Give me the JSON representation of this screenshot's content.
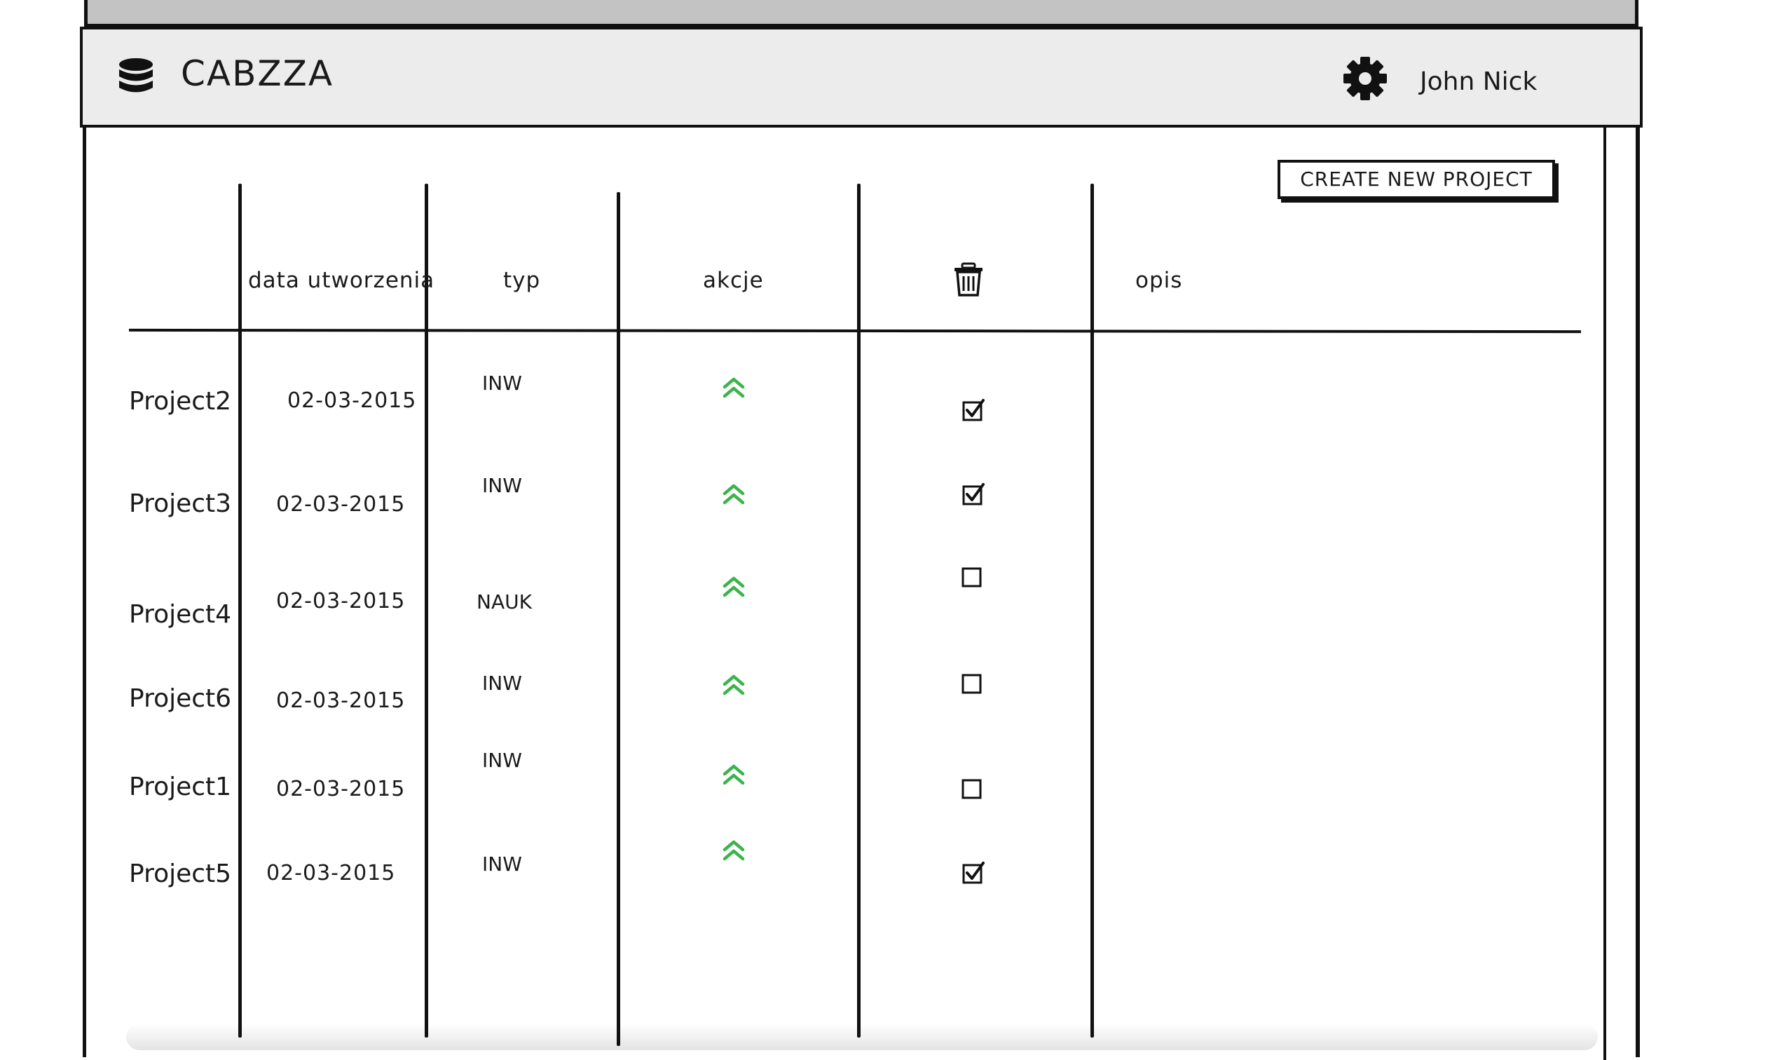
{
  "app": {
    "title": "CABZZA",
    "logo_icon": "database-icon",
    "settings_icon": "gear-icon",
    "user_name": "John Nick"
  },
  "toolbar": {
    "create_label": "CREATE NEW PROJECT"
  },
  "table": {
    "headers": {
      "name": "",
      "date": "data utworzenia",
      "type": "typ",
      "actions": "akcje",
      "delete_icon": "trash-icon",
      "description": "opis"
    },
    "rows": [
      {
        "name": "Project2",
        "date": "02-03-2015",
        "type": "INW",
        "action_icon": "double-chevron-up-icon",
        "checked": true,
        "description": ""
      },
      {
        "name": "Project3",
        "date": "02-03-2015",
        "type": "INW",
        "action_icon": "double-chevron-up-icon",
        "checked": true,
        "description": ""
      },
      {
        "name": "Project4",
        "date": "02-03-2015",
        "type": "NAUK",
        "action_icon": "double-chevron-up-icon",
        "checked": false,
        "description": ""
      },
      {
        "name": "Project6",
        "date": "02-03-2015",
        "type": "INW",
        "action_icon": "double-chevron-up-icon",
        "checked": false,
        "description": ""
      },
      {
        "name": "Project1",
        "date": "02-03-2015",
        "type": "INW",
        "action_icon": "double-chevron-up-icon",
        "checked": false,
        "description": ""
      },
      {
        "name": "Project5",
        "date": "02-03-2015",
        "type": "INW",
        "action_icon": "double-chevron-up-icon",
        "checked": true,
        "description": ""
      }
    ]
  },
  "colors": {
    "accent_green": "#3cb44b",
    "header_bg": "#ececec",
    "top_strip": "#c3c3c3",
    "ink": "#111111"
  }
}
